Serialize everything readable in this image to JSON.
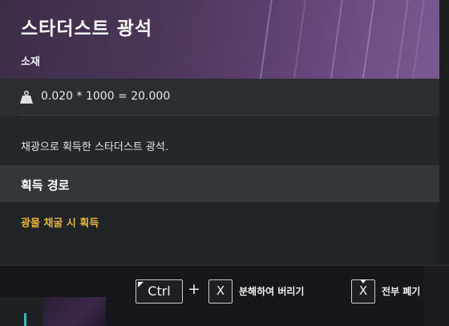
{
  "item": {
    "name": "스타더스트 광석",
    "category": "소재",
    "weight_formula": "0.020 * 1000 = 20.000",
    "description": "채광으로 획득한 스타더스트 광석."
  },
  "acquisition": {
    "title": "획득 경로",
    "sources": [
      "광물 채굴 시 획득"
    ]
  },
  "footer": {
    "ctrl_key": "Ctrl",
    "plus": "+",
    "key_x": "X",
    "dismantle_label": "분해하여 버리기",
    "discard_all_label": "전부 폐기"
  },
  "colors": {
    "header_accent": "#5d4170",
    "source_text": "#e4b43c"
  }
}
